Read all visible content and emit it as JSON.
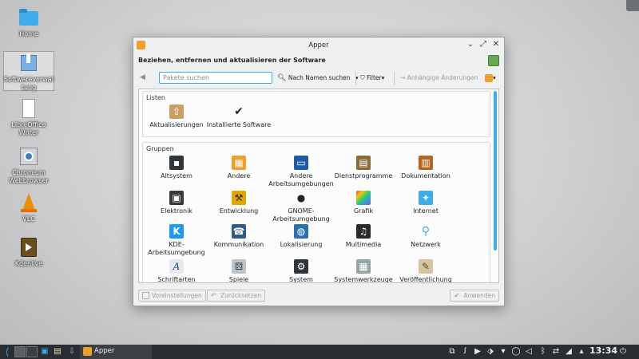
{
  "desktop": {
    "icons": [
      {
        "label": "Home",
        "icon": "folder-home-icon"
      },
      {
        "label": "Softwareverwaltung",
        "icon": "software-package-icon"
      },
      {
        "label": "LibreOffice Writer",
        "icon": "document-icon"
      },
      {
        "label": "Chromium Webbrowser",
        "icon": "chromium-icon"
      },
      {
        "label": "VLC",
        "icon": "vlc-cone-icon"
      },
      {
        "label": "Kdenlive",
        "icon": "kdenlive-icon"
      }
    ]
  },
  "window": {
    "title": "Apper",
    "header": "Beziehen, entfernen und aktualisieren der Software",
    "search_placeholder": "Pakete suchen",
    "search_mode": "Nach Namen suchen",
    "filter_label": "Filter",
    "pending_label": "Anhängige Änderungen",
    "lists_title": "Listen",
    "lists": [
      {
        "label": "Aktualisierungen",
        "icon": "updates-icon"
      },
      {
        "label": "Installierte Software",
        "icon": "checkmark-icon"
      }
    ],
    "groups_title": "Gruppen",
    "groups": [
      {
        "label": "Altsystem",
        "icon": "floppy-icon",
        "color": "#31363b"
      },
      {
        "label": "Andere",
        "icon": "other-grid-icon",
        "color": "#f29e2a"
      },
      {
        "label": "Andere Arbeitsumgebungen",
        "icon": "desktop-environment-icon",
        "color": "#1d5aa8"
      },
      {
        "label": "Dienstprogramme",
        "icon": "utilities-icon",
        "color": "#8a6a3a"
      },
      {
        "label": "Dokumentation",
        "icon": "documentation-book-icon",
        "color": "#b5651d"
      },
      {
        "label": "Elektronik",
        "icon": "electronics-icon",
        "color": "#3a3a3a"
      },
      {
        "label": "Entwicklung",
        "icon": "development-icon",
        "color": "#e0a800"
      },
      {
        "label": "GNOME-Arbeitsumgebung",
        "icon": "gnome-foot-icon",
        "color": "#232627"
      },
      {
        "label": "Grafik",
        "icon": "graphics-icon",
        "color": "#c0392b"
      },
      {
        "label": "Internet",
        "icon": "internet-icon",
        "color": "#3daee9"
      },
      {
        "label": "KDE-Arbeitsumgebung",
        "icon": "kde-icon",
        "color": "#1d99f3"
      },
      {
        "label": "Kommunikation",
        "icon": "communication-icon",
        "color": "#2c5a8a"
      },
      {
        "label": "Lokalisierung",
        "icon": "localization-globe-icon",
        "color": "#2a6fb0"
      },
      {
        "label": "Multimedia",
        "icon": "multimedia-icon",
        "color": "#2a2a2a"
      },
      {
        "label": "Netzwerk",
        "icon": "network-icon",
        "color": "#3daee9"
      },
      {
        "label": "Schriftarten",
        "icon": "fonts-icon",
        "color": "#e8e8f0"
      },
      {
        "label": "Spiele",
        "icon": "games-icon",
        "color": "#7f8c8d"
      },
      {
        "label": "System",
        "icon": "system-icon",
        "color": "#31363b"
      },
      {
        "label": "Systemwerkzeuge",
        "icon": "system-tools-icon",
        "color": "#95a5a6"
      },
      {
        "label": "Veröffentlichung",
        "icon": "publishing-icon",
        "color": "#d4c4a0"
      }
    ],
    "buttons": {
      "defaults": "Voreinstellungen",
      "reset": "Zurücksetzen",
      "apply": "Anwenden"
    }
  },
  "taskbar": {
    "task_label": "Apper",
    "clock": "13:34"
  }
}
